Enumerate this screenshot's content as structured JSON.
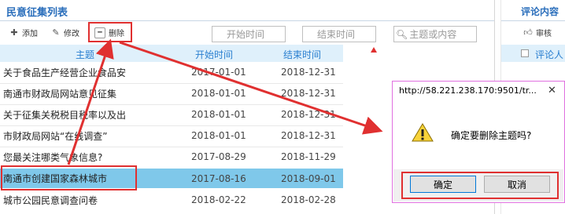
{
  "left_panel": {
    "title": "民意征集列表",
    "toolbar": {
      "add": "添加",
      "edit": "修改",
      "delete": "删除"
    },
    "filters": {
      "start_time_placeholder": "开始时间",
      "end_time_placeholder": "结束时间",
      "search_placeholder": "主题或内容"
    },
    "table": {
      "headers": [
        "主题",
        "开始时间",
        "结束时间"
      ],
      "rows": [
        {
          "title": "关于食品生产经营企业食品安",
          "start": "2017-01-01",
          "end": "2018-12-31"
        },
        {
          "title": "南通市财政局网站意见征集",
          "start": "2018-01-01",
          "end": "2018-12-31"
        },
        {
          "title": "关于征集关税税目税率以及出",
          "start": "2018-01-01",
          "end": "2018-12-31"
        },
        {
          "title": "市财政局网站“在线调查”",
          "start": "2018-01-01",
          "end": "2018-12-31"
        },
        {
          "title": "您最关注哪类气象信息?",
          "start": "2017-08-29",
          "end": "2018-11-29"
        },
        {
          "title": "南通市创建国家森林城市",
          "start": "2017-08-16",
          "end": "2018-09-01"
        },
        {
          "title": "城市公园民意调查问卷",
          "start": "2018-02-22",
          "end": "2018-02-28"
        }
      ]
    }
  },
  "right_panel": {
    "title": "评论内容",
    "toolbar_audit": "审核",
    "first_item": "评论人"
  },
  "dialog": {
    "url": "http://58.221.238.170:9501/tr...",
    "message": "确定要删除主题吗?",
    "ok": "确定",
    "cancel": "取消"
  }
}
